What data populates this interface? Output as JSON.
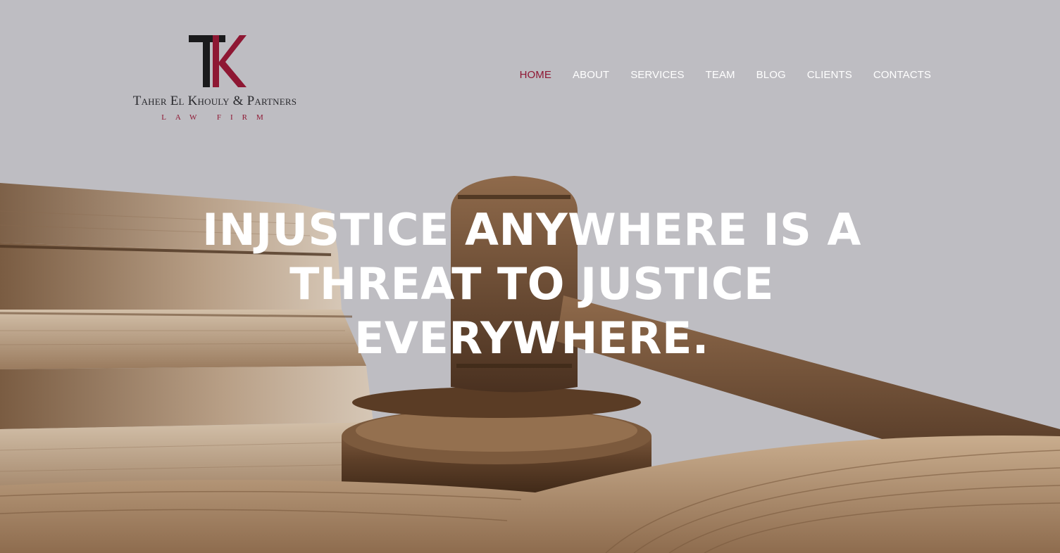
{
  "brand": {
    "monogram": "TK",
    "name": "Taher El Khouly & Partners",
    "subtitle": "LAW FIRM",
    "colors": {
      "dark": "#1a1a1c",
      "accent": "#8e1733"
    }
  },
  "nav": {
    "items": [
      {
        "label": "HOME",
        "active": true
      },
      {
        "label": "ABOUT",
        "active": false
      },
      {
        "label": "SERVICES",
        "active": false
      },
      {
        "label": "TEAM",
        "active": false
      },
      {
        "label": "BLOG",
        "active": false
      },
      {
        "label": "CLIENTS",
        "active": false
      },
      {
        "label": "CONTACTS",
        "active": false
      }
    ]
  },
  "hero": {
    "headline": "INJUSTICE ANYWHERE IS A THREAT TO JUSTICE EVERYWHERE."
  },
  "colors": {
    "background": "#bebdc2",
    "nav_text": "#ffffff",
    "nav_active": "#8e1733",
    "headline": "#ffffff"
  }
}
